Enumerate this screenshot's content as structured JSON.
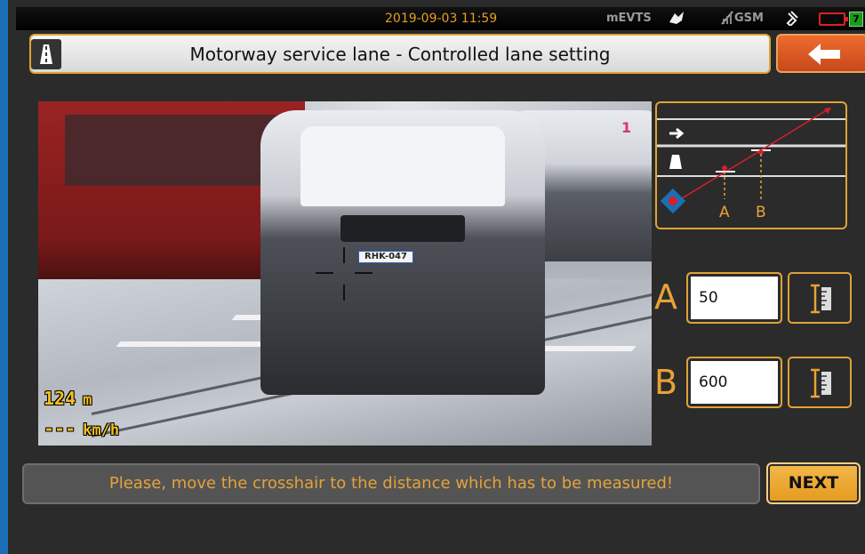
{
  "status_bar": {
    "datetime": "2019-09-03 11:59",
    "mode": "mEVTS",
    "gsm": "GSM",
    "charge": "7"
  },
  "header": {
    "title": "Motorway service lane - Controlled lane setting",
    "back_icon": "arrow-left-icon"
  },
  "camera": {
    "distance_value": "124",
    "distance_unit": "m",
    "speed_value": "---",
    "speed_unit": "km/h",
    "plate": "RHK-047",
    "lane_marker": "1"
  },
  "diagram": {
    "label_a": "A",
    "label_b": "B"
  },
  "fields": {
    "a_label": "A",
    "a_value": "50",
    "b_label": "B",
    "b_value": "600",
    "measure_icon": "ruler-icon"
  },
  "footer": {
    "message": "Please, move the crosshair to the distance which has to be measured!",
    "next_label": "NEXT"
  },
  "colors": {
    "accent": "#e0a336",
    "back_button": "#e05a22",
    "message_text": "#e5a23a",
    "window_border": "#1d6fb5"
  }
}
